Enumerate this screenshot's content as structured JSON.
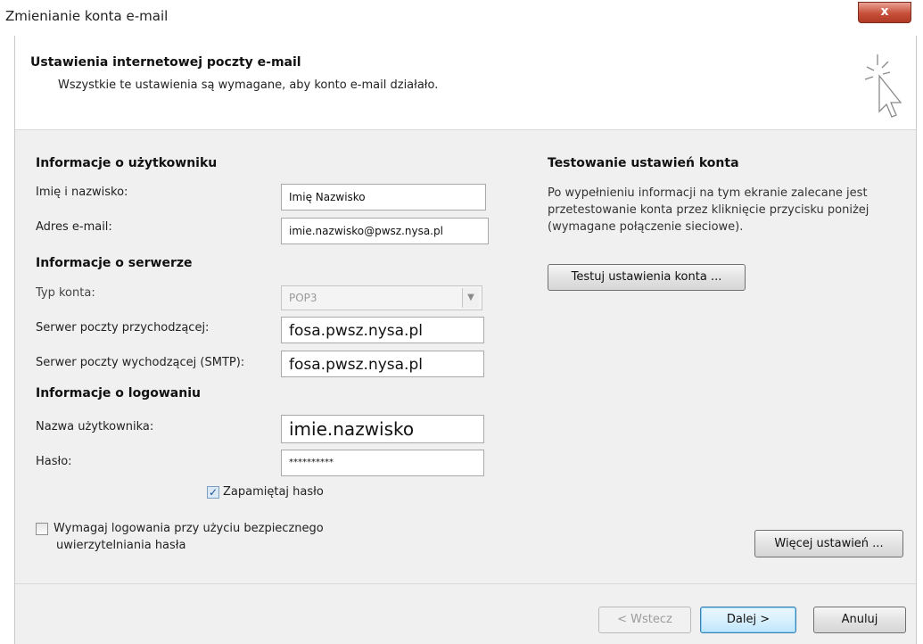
{
  "window": {
    "title": "Zmienianie konta e-mail",
    "close_label": "x"
  },
  "header": {
    "title": "Ustawienia internetowej poczty e-mail",
    "subtitle": "Wszystkie te ustawienia są wymagane, aby konto e-mail działało.",
    "icon": "cursor-sparkle-icon"
  },
  "user_info": {
    "heading": "Informacje o użytkowniku",
    "name_label": "Imię i nazwisko:",
    "name_value": "Imię Nazwisko",
    "email_label": "Adres e-mail:",
    "email_value": "imie.nazwisko@pwsz.nysa.pl"
  },
  "server_info": {
    "heading": "Informacje o serwerze",
    "account_type_label": "Typ konta:",
    "account_type_value": "POP3",
    "incoming_label": "Serwer poczty przychodzącej:",
    "incoming_value": "fosa.pwsz.nysa.pl",
    "outgoing_label": "Serwer poczty wychodzącej (SMTP):",
    "outgoing_value": "fosa.pwsz.nysa.pl"
  },
  "logon_info": {
    "heading": "Informacje o logowaniu",
    "username_label": "Nazwa użytkownika:",
    "username_value": "imie.nazwisko",
    "password_label": "Hasło:",
    "password_value": "**********",
    "remember_label": "Zapamiętaj hasło",
    "remember_checked": true,
    "spa_label_line1": "Wymagaj logowania przy użyciu bezpiecznego",
    "spa_label_line2": "uwierzytelniania hasła",
    "spa_checked": false
  },
  "test_settings": {
    "heading": "Testowanie ustawień konta",
    "description_line1": "Po wypełnieniu informacji na tym ekranie zalecane jest",
    "description_line2": "przetestowanie konta przez kliknięcie przycisku poniżej",
    "description_line3": "(wymagane połączenie sieciowe).",
    "test_button": "Testuj ustawienia konta ...",
    "more_button": "Więcej ustawień ..."
  },
  "footer": {
    "back_button": "< Wstecz",
    "next_button": "Dalej >",
    "cancel_button": "Anuluj"
  }
}
